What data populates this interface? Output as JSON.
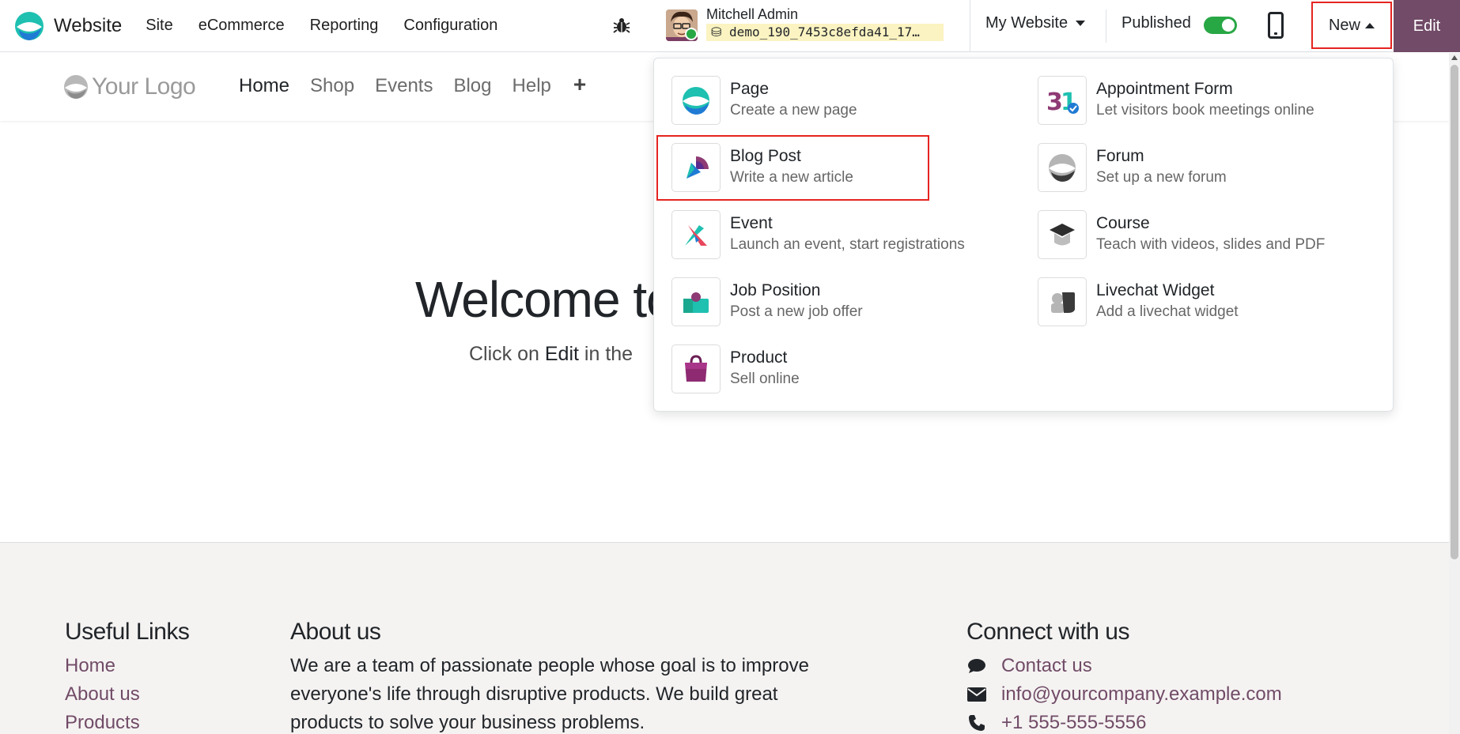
{
  "topbar": {
    "app_name": "Website",
    "menu": [
      "Site",
      "eCommerce",
      "Reporting",
      "Configuration"
    ],
    "user_name": "Mitchell Admin",
    "database": "demo_190_7453c8efda41_17…",
    "website_selector": "My Website",
    "published_label": "Published",
    "published": true,
    "new_label": "New",
    "edit_label": "Edit"
  },
  "site": {
    "logo_text": "Your Logo",
    "nav": [
      "Home",
      "Shop",
      "Events",
      "Blog",
      "Help"
    ],
    "active_nav": "Home",
    "hero_title": "Welcome to",
    "hero_sub_prefix": "Click on ",
    "hero_sub_bold": "Edit",
    "hero_sub_suffix": " in the"
  },
  "new_menu": {
    "items": [
      {
        "title": "Page",
        "desc": "Create a new page",
        "icon": "page-icon"
      },
      {
        "title": "Appointment Form",
        "desc": "Let visitors book meetings online",
        "icon": "calendar-icon"
      },
      {
        "title": "Blog Post",
        "desc": "Write a new article",
        "icon": "blog-icon"
      },
      {
        "title": "Forum",
        "desc": "Set up a new forum",
        "icon": "forum-icon"
      },
      {
        "title": "Event",
        "desc": "Launch an event, start registrations",
        "icon": "event-icon"
      },
      {
        "title": "Course",
        "desc": "Teach with videos, slides and PDF",
        "icon": "course-icon"
      },
      {
        "title": "Job Position",
        "desc": "Post a new job offer",
        "icon": "job-icon"
      },
      {
        "title": "Livechat Widget",
        "desc": "Add a livechat widget",
        "icon": "livechat-icon"
      },
      {
        "title": "Product",
        "desc": "Sell online",
        "icon": "product-icon"
      }
    ]
  },
  "footer": {
    "links_title": "Useful Links",
    "links": [
      "Home",
      "About us",
      "Products"
    ],
    "about_title": "About us",
    "about_text": "We are a team of passionate people whose goal is to improve everyone's life through disruptive products. We build great products to solve your business problems.",
    "connect_title": "Connect with us",
    "contacts": [
      {
        "icon": "chat-icon",
        "text": "Contact us"
      },
      {
        "icon": "envelope-icon",
        "text": "info@yourcompany.example.com"
      },
      {
        "icon": "phone-icon",
        "text": "+1 555-555-5556"
      }
    ]
  },
  "colors": {
    "brand": "#714b67",
    "highlight": "#e52420",
    "toggle_on": "#28a745"
  }
}
